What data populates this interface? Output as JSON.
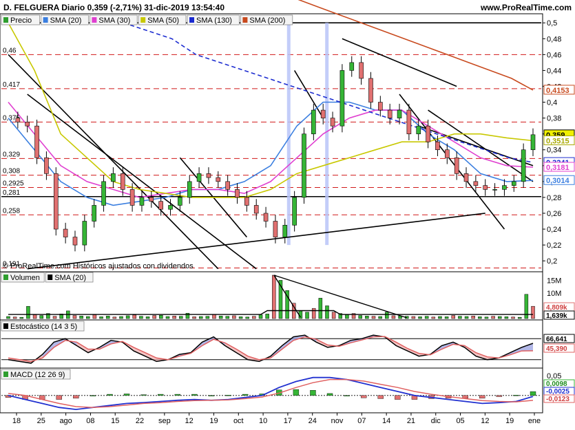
{
  "header": {
    "title": "D. FELGUERA Diario 0,359 (-2,71%) 31-dic-2019 13:54:40",
    "site": "www.ProRealTime.com"
  },
  "price_legend": [
    {
      "label": "Precio",
      "color": "#2f9e2f"
    },
    {
      "label": "SMA (20)",
      "color": "#3b7fe0"
    },
    {
      "label": "SMA (30)",
      "color": "#e040d0"
    },
    {
      "label": "SMA (50)",
      "color": "#c8c800"
    },
    {
      "label": "SMA (130)",
      "color": "#1b2bd0"
    },
    {
      "label": "SMA (200)",
      "color": "#c84a1e"
    }
  ],
  "copyright": "© ProRealTime.com  Históricos ajustados con dividendos",
  "volume_legend": [
    {
      "label": "Volumen",
      "color": "#2f9e2f"
    },
    {
      "label": "SMA (20)",
      "color": "#000000"
    }
  ],
  "stoch_legend": {
    "label": "Estocástico (14 3 5)",
    "color": "#000000"
  },
  "macd_legend": {
    "label": "MACD (12 26 9)",
    "color": "#2f9e2f"
  },
  "price_axis": {
    "ticks": [
      "0,5",
      "0,48",
      "0,46",
      "0,44",
      "0,42",
      "0,4",
      "0,38",
      "0,36",
      "0,34",
      "0,32",
      "0,3",
      "0,28",
      "0,26",
      "0,24",
      "0,22",
      "0,2"
    ],
    "boxes": [
      {
        "label": "0,4153",
        "value": 0.4153,
        "color": "#c84a1e",
        "fill": "#ffffff"
      },
      {
        "label": "0,359",
        "value": 0.359,
        "color": "#000000",
        "fill": "#f0f000"
      },
      {
        "label": "0,3515",
        "value": 0.3515,
        "color": "#a8a800",
        "fill": "#ffffff"
      },
      {
        "label": "0,3241",
        "value": 0.3241,
        "color": "#1b2bd0",
        "fill": "#ffffff"
      },
      {
        "label": "0,3181",
        "value": 0.3181,
        "color": "#e040d0",
        "fill": "#ffffff"
      },
      {
        "label": "0,3014",
        "value": 0.3014,
        "color": "#3b7fe0",
        "fill": "#ffffff"
      }
    ]
  },
  "left_levels": [
    {
      "label": "0,46",
      "value": 0.46
    },
    {
      "label": "0,417",
      "value": 0.417
    },
    {
      "label": "0,375",
      "value": 0.375
    },
    {
      "label": "0,329",
      "value": 0.329
    },
    {
      "label": "0,308",
      "value": 0.308
    },
    {
      "label": "0,2925",
      "value": 0.2925
    },
    {
      "label": "0,281",
      "value": 0.281
    },
    {
      "label": "0,258",
      "value": 0.258
    },
    {
      "label": "0,191",
      "value": 0.191
    }
  ],
  "volume_axis": {
    "ticks": [
      "15M",
      "10M",
      "5M"
    ],
    "box_red": "4,809k",
    "box_black": "1,639k"
  },
  "stoch_axis": {
    "box_black": "66,641",
    "box_red": "45,390"
  },
  "macd_axis": {
    "ticks": [
      "0,05"
    ],
    "box_green": "0,0098",
    "box_blue": "-0,0025",
    "box_red": "-0,0123"
  },
  "x_axis": {
    "labels": [
      "18",
      "25",
      "ago",
      "08",
      "15",
      "22",
      "sep",
      "12",
      "19",
      "oct",
      "10",
      "17",
      "24",
      "nov",
      "07",
      "14",
      "21",
      "dic",
      "05",
      "12",
      "19",
      "ene"
    ]
  },
  "chart_data": [
    {
      "type": "candlestick",
      "title": "D. FELGUERA Diario 0,359 (-2,71%) 31-dic-2019 13:54:40",
      "xlabel": "",
      "ylabel": "",
      "ylim": [
        0.188,
        0.508
      ],
      "categories": [
        "18",
        "25",
        "ago",
        "08",
        "15",
        "22",
        "sep",
        "12",
        "19",
        "oct",
        "10",
        "17",
        "24",
        "nov",
        "07",
        "14",
        "21",
        "dic",
        "05",
        "12",
        "19",
        "ene"
      ],
      "horizontal_levels": [
        0.5,
        0.281
      ],
      "dashed_levels": [
        0.46,
        0.417,
        0.375,
        0.329,
        0.308,
        0.2925,
        0.258,
        0.191
      ],
      "close_path": [
        0.38,
        0.375,
        0.37,
        0.33,
        0.31,
        0.24,
        0.23,
        0.22,
        0.25,
        0.27,
        0.3,
        0.31,
        0.29,
        0.27,
        0.28,
        0.275,
        0.265,
        0.27,
        0.28,
        0.3,
        0.31,
        0.305,
        0.3,
        0.29,
        0.28,
        0.27,
        0.26,
        0.25,
        0.23,
        0.245,
        0.28,
        0.36,
        0.39,
        0.38,
        0.37,
        0.44,
        0.45,
        0.43,
        0.4,
        0.39,
        0.38,
        0.39,
        0.36,
        0.37,
        0.35,
        0.34,
        0.33,
        0.31,
        0.3,
        0.295,
        0.29,
        0.29,
        0.295,
        0.3,
        0.34,
        0.359
      ],
      "series": [
        {
          "name": "SMA (20)",
          "values": [
            0.38,
            0.34,
            0.3,
            0.28,
            0.27,
            0.275,
            0.28,
            0.29,
            0.29,
            0.3,
            0.32,
            0.37,
            0.4,
            0.4,
            0.39,
            0.39,
            0.36,
            0.34,
            0.31,
            0.3,
            0.3014
          ]
        },
        {
          "name": "SMA (30)",
          "values": [
            0.4,
            0.36,
            0.32,
            0.3,
            0.29,
            0.28,
            0.285,
            0.29,
            0.29,
            0.285,
            0.3,
            0.33,
            0.36,
            0.38,
            0.39,
            0.39,
            0.37,
            0.35,
            0.33,
            0.32,
            0.3181
          ]
        },
        {
          "name": "SMA (50)",
          "values": [
            0.5,
            0.44,
            0.36,
            0.33,
            0.3,
            0.29,
            0.285,
            0.28,
            0.28,
            0.28,
            0.29,
            0.31,
            0.32,
            0.33,
            0.34,
            0.35,
            0.35,
            0.36,
            0.36,
            0.355,
            0.3515
          ]
        },
        {
          "name": "SMA (130)",
          "values": [
            0.5,
            0.49,
            0.48,
            0.46,
            0.45,
            0.44,
            0.43,
            0.42,
            0.41,
            0.4,
            0.39,
            0.38,
            0.37,
            0.36,
            0.35,
            0.34,
            0.33,
            0.3241
          ]
        },
        {
          "name": "SMA (200)",
          "values": [
            0.53,
            0.52,
            0.51,
            0.5,
            0.49,
            0.48,
            0.47,
            0.46,
            0.45,
            0.44,
            0.43,
            0.4153
          ]
        }
      ]
    },
    {
      "type": "bar",
      "title": "Volumen",
      "xlabel": "",
      "ylabel": "",
      "ylim": [
        0,
        17
      ],
      "values": [
        0.8,
        0.6,
        0.5,
        4.8,
        1.5,
        1.2,
        2.0,
        0.9,
        1.8,
        3.0,
        1.2,
        1.0,
        0.8,
        1.5,
        0.7,
        1.0,
        0.6,
        0.8,
        1.1,
        1.4,
        0.9,
        0.7,
        1.2,
        1.3,
        0.8,
        1.0,
        0.9,
        2.1,
        0.7,
        0.8,
        0.9,
        1.6,
        1.0,
        0.9,
        1.1,
        0.7,
        0.6,
        0.9,
        1.5,
        1.8,
        17.0,
        15.0,
        11.0,
        6.0,
        3.0,
        2.5,
        4.0,
        8.0,
        5.0,
        2.5,
        2.0,
        1.5,
        2.0,
        1.2,
        1.0,
        0.9,
        0.8,
        2.5,
        1.1,
        1.0,
        0.9,
        0.8,
        0.7,
        0.9,
        0.6,
        0.8,
        0.7,
        1.2,
        0.9,
        0.8,
        1.0,
        0.7,
        0.6,
        0.9,
        0.8,
        0.7,
        0.6,
        0.5,
        9.5,
        4.809
      ],
      "series": [
        {
          "name": "SMA (20)",
          "last": 1.639
        }
      ]
    },
    {
      "type": "line",
      "title": "Estocástico (14 3 5)",
      "xlabel": "",
      "ylabel": "",
      "ylim": [
        0,
        100
      ],
      "series": [
        {
          "name": "%K",
          "values": [
            20,
            15,
            10,
            35,
            70,
            80,
            60,
            40,
            55,
            75,
            70,
            45,
            30,
            15,
            20,
            35,
            40,
            70,
            85,
            60,
            40,
            20,
            15,
            30,
            60,
            85,
            90,
            70,
            55,
            60,
            75,
            80,
            90,
            85,
            60,
            45,
            30,
            35,
            60,
            70,
            55,
            30,
            20,
            25,
            40,
            55,
            66.641
          ]
        },
        {
          "name": "%D",
          "values": [
            25,
            20,
            15,
            25,
            55,
            75,
            70,
            50,
            50,
            65,
            72,
            55,
            40,
            25,
            20,
            30,
            38,
            60,
            78,
            68,
            50,
            30,
            20,
            25,
            50,
            75,
            85,
            78,
            62,
            58,
            68,
            76,
            85,
            86,
            70,
            52,
            38,
            34,
            50,
            64,
            60,
            40,
            28,
            25,
            34,
            45,
            45.39
          ]
        }
      ]
    },
    {
      "type": "line",
      "title": "MACD (12 26 9)",
      "xlabel": "",
      "ylabel": "",
      "ylim": [
        -0.04,
        0.06
      ],
      "series": [
        {
          "name": "MACD",
          "values": [
            0.0,
            -0.01,
            -0.02,
            -0.03,
            -0.035,
            -0.03,
            -0.025,
            -0.02,
            -0.018,
            -0.015,
            -0.012,
            -0.01,
            -0.012,
            -0.01,
            -0.005,
            0.0,
            0.02,
            0.035,
            0.045,
            0.045,
            0.04,
            0.03,
            0.02,
            0.01,
            0.0,
            -0.005,
            -0.01,
            -0.015,
            -0.02,
            -0.018,
            -0.015,
            -0.0025
          ]
        },
        {
          "name": "Señal",
          "values": [
            0.005,
            0.0,
            -0.01,
            -0.02,
            -0.028,
            -0.03,
            -0.028,
            -0.024,
            -0.02,
            -0.018,
            -0.015,
            -0.013,
            -0.012,
            -0.011,
            -0.008,
            -0.004,
            0.006,
            0.02,
            0.032,
            0.04,
            0.04,
            0.036,
            0.028,
            0.02,
            0.01,
            0.003,
            -0.003,
            -0.008,
            -0.013,
            -0.015,
            -0.016,
            -0.0123
          ]
        },
        {
          "name": "Histograma",
          "values": [
            -0.005,
            -0.01,
            -0.01,
            -0.01,
            -0.007,
            0.0,
            0.003,
            0.004,
            0.002,
            0.003,
            0.003,
            0.003,
            0.0,
            0.001,
            0.003,
            0.004,
            0.014,
            0.015,
            0.013,
            0.005,
            0.0,
            -0.006,
            -0.008,
            -0.01,
            -0.01,
            -0.008,
            -0.007,
            -0.007,
            -0.007,
            -0.003,
            0.001,
            0.0098
          ]
        }
      ]
    }
  ]
}
